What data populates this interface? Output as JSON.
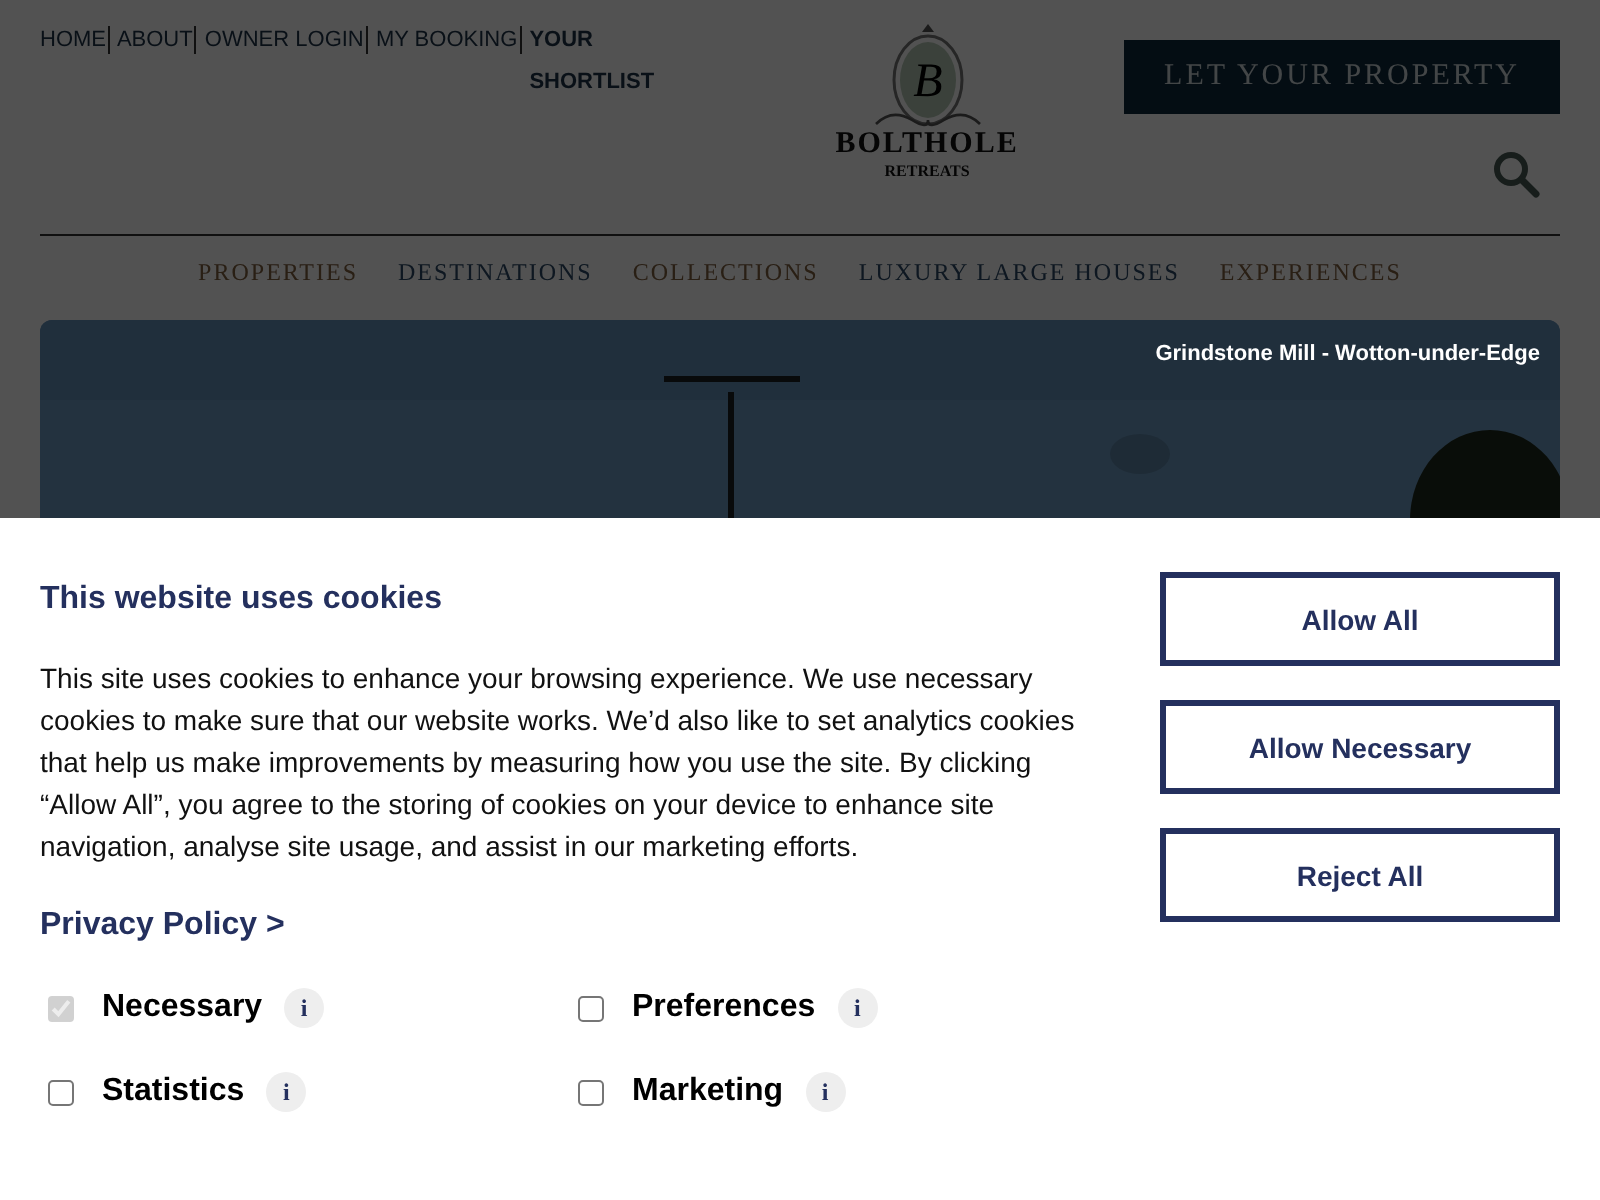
{
  "top_links": [
    {
      "label": "HOME",
      "bold": false
    },
    {
      "label": "ABOUT",
      "bold": false
    },
    {
      "label": "OWNER LOGIN",
      "bold": false
    },
    {
      "label": "MY BOOKING",
      "bold": false
    },
    {
      "label": "YOUR SHORTLIST",
      "bold": true
    }
  ],
  "logo": {
    "monogram": "B",
    "name": "BOLTHOLE",
    "tagline": "RETREATS"
  },
  "cta_button": "LET YOUR PROPERTY",
  "nav": [
    "PROPERTIES",
    "DESTINATIONS",
    "COLLECTIONS",
    "LUXURY LARGE HOUSES",
    "EXPERIENCES"
  ],
  "hero": {
    "kind": "picture",
    "caption": "Grindstone Mill - Wotton-under-Edge"
  },
  "cookie_banner": {
    "title": "This website uses cookies",
    "body": "This site uses cookies to enhance your browsing experience. We use necessary cookies to make sure that our website works. We’d also like to set analytics cookies that help us make improvements by measuring how you use the site. By clicking “Allow All”, you agree to the storing of cookies on your device to enhance site navigation, analyse site usage, and assist in our marketing efforts.",
    "privacy_link": "Privacy Policy >",
    "categories": [
      {
        "label": "Necessary",
        "checked": true,
        "disabled": true,
        "info": "i"
      },
      {
        "label": "Preferences",
        "checked": false,
        "disabled": false,
        "info": "i"
      },
      {
        "label": "Statistics",
        "checked": false,
        "disabled": false,
        "info": "i"
      },
      {
        "label": "Marketing",
        "checked": false,
        "disabled": false,
        "info": "i"
      }
    ],
    "buttons": [
      "Allow All",
      "Allow Necessary",
      "Reject All"
    ]
  }
}
